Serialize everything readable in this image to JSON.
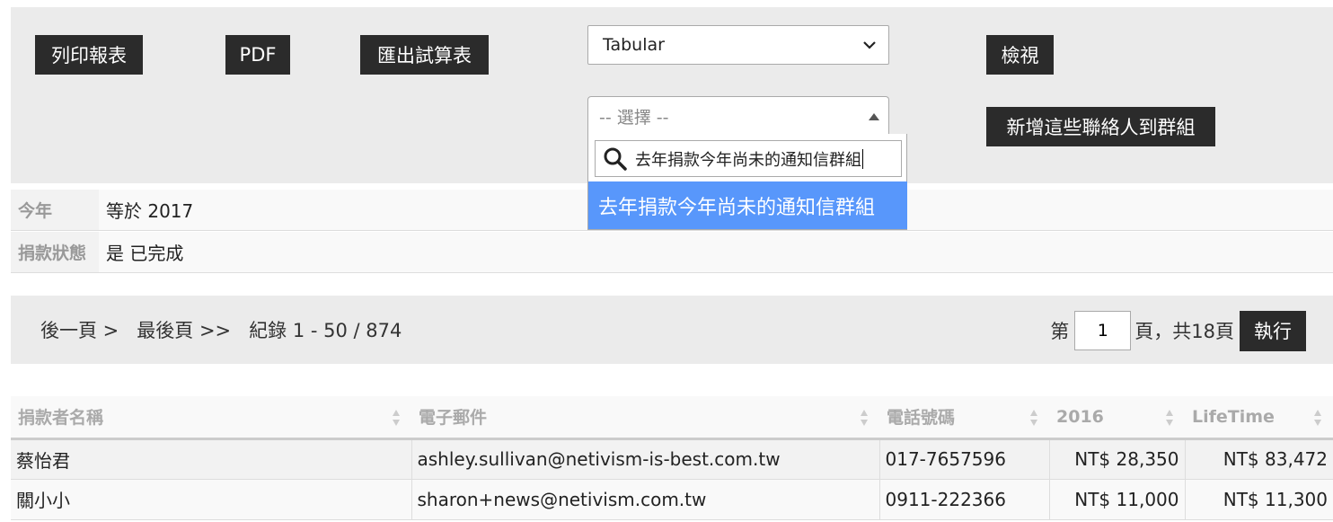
{
  "toolbar": {
    "print_label": "列印報表",
    "pdf_label": "PDF",
    "export_label": "匯出試算表",
    "view_label": "檢視",
    "add_group_label": "新增這些聯絡人到群組",
    "format_select_value": "Tabular",
    "group_select_placeholder": "-- 選擇 --",
    "group_search_text": "去年捐款今年尚未的通知信群組",
    "group_option": "去年捐款今年尚未的通知信群組"
  },
  "filters": [
    {
      "label": "今年",
      "value": "等於 2017"
    },
    {
      "label": "捐款狀態",
      "value": "是 已完成"
    }
  ],
  "pager": {
    "next_label": "後一頁 >",
    "last_label": "最後頁 >>",
    "records_label": "紀錄 1 - 50 / 874",
    "page_prefix": "第",
    "page_value": "1",
    "page_suffix": "頁，共18頁",
    "go_label": "執行"
  },
  "table": {
    "columns": [
      "捐款者名稱",
      "電子郵件",
      "電話號碼",
      "2016",
      "LifeTime"
    ],
    "rows": [
      [
        "蔡怡君",
        "ashley.sullivan@netivism-is-best.com.tw",
        "017-7657596",
        "NT$ 28,350",
        "NT$ 83,472"
      ],
      [
        "關小小",
        "sharon+news@netivism.com.tw",
        "0911-222366",
        "NT$ 11,000",
        "NT$ 11,300"
      ]
    ]
  },
  "icons": {
    "search": "search-icon",
    "chevron": "chevron-down-icon",
    "caret": "caret-up-icon",
    "sort": "sort-icon"
  },
  "colors": {
    "dark_button": "#2b2b2b",
    "highlight": "#5897fb",
    "panel": "#ebebeb"
  }
}
